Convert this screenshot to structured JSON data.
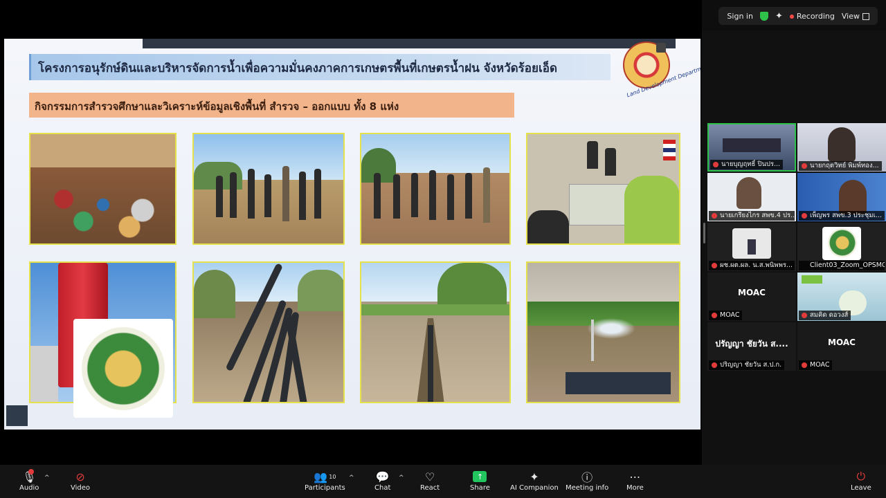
{
  "top_bar": {
    "sign_in": "Sign in",
    "recording": "Recording",
    "view": "View"
  },
  "slide": {
    "title": "โครงการอนุรักษ์ดินและบริหารจัดการน้ำเพื่อความมั่นคงภาคการเกษตรพื้นที่เกษตรน้ำฝน จังหวัดร้อยเอ็ด",
    "subtitle": "กิจกรรมการสำรวจศึกษาและวิเคราะห์ข้อมูลเชิงพื้นที่ สำรวจ – ออกแบบ ทั้ง 8 แห่ง",
    "ldd_logo_caption": "Land Development Department"
  },
  "participants": [
    {
      "name": "นายบุญฤทธิ์ ปินปร..."
    },
    {
      "name": "นายกฤตวิทย์ พิมพ์ทอง..."
    },
    {
      "name": "นายเกรียงไกร สพข.4 ปร..."
    },
    {
      "name": "เพ็ญพร สพข.3 ประชุมเ..."
    },
    {
      "name": "ผช.ผต.ผล. น.ส.พนิพพร..."
    },
    {
      "name": "Client03_Zoom_OPSMOAC"
    },
    {
      "display": "MOAC",
      "name": "MOAC"
    },
    {
      "name": "สมคิด ดอวงส์"
    },
    {
      "display": "ปรัญญา ชัยวัน ส....",
      "name": "ปริญญา ชัยวัน ส.ป.ก."
    },
    {
      "display": "MOAC",
      "name": "MOAC"
    }
  ],
  "toolbar": {
    "audio": "Audio",
    "video": "Video",
    "participants": "Participants",
    "participants_count": "10",
    "chat": "Chat",
    "react": "React",
    "share": "Share",
    "ai_companion": "AI Companion",
    "meeting_info": "Meeting info",
    "more": "More",
    "leave": "Leave"
  }
}
